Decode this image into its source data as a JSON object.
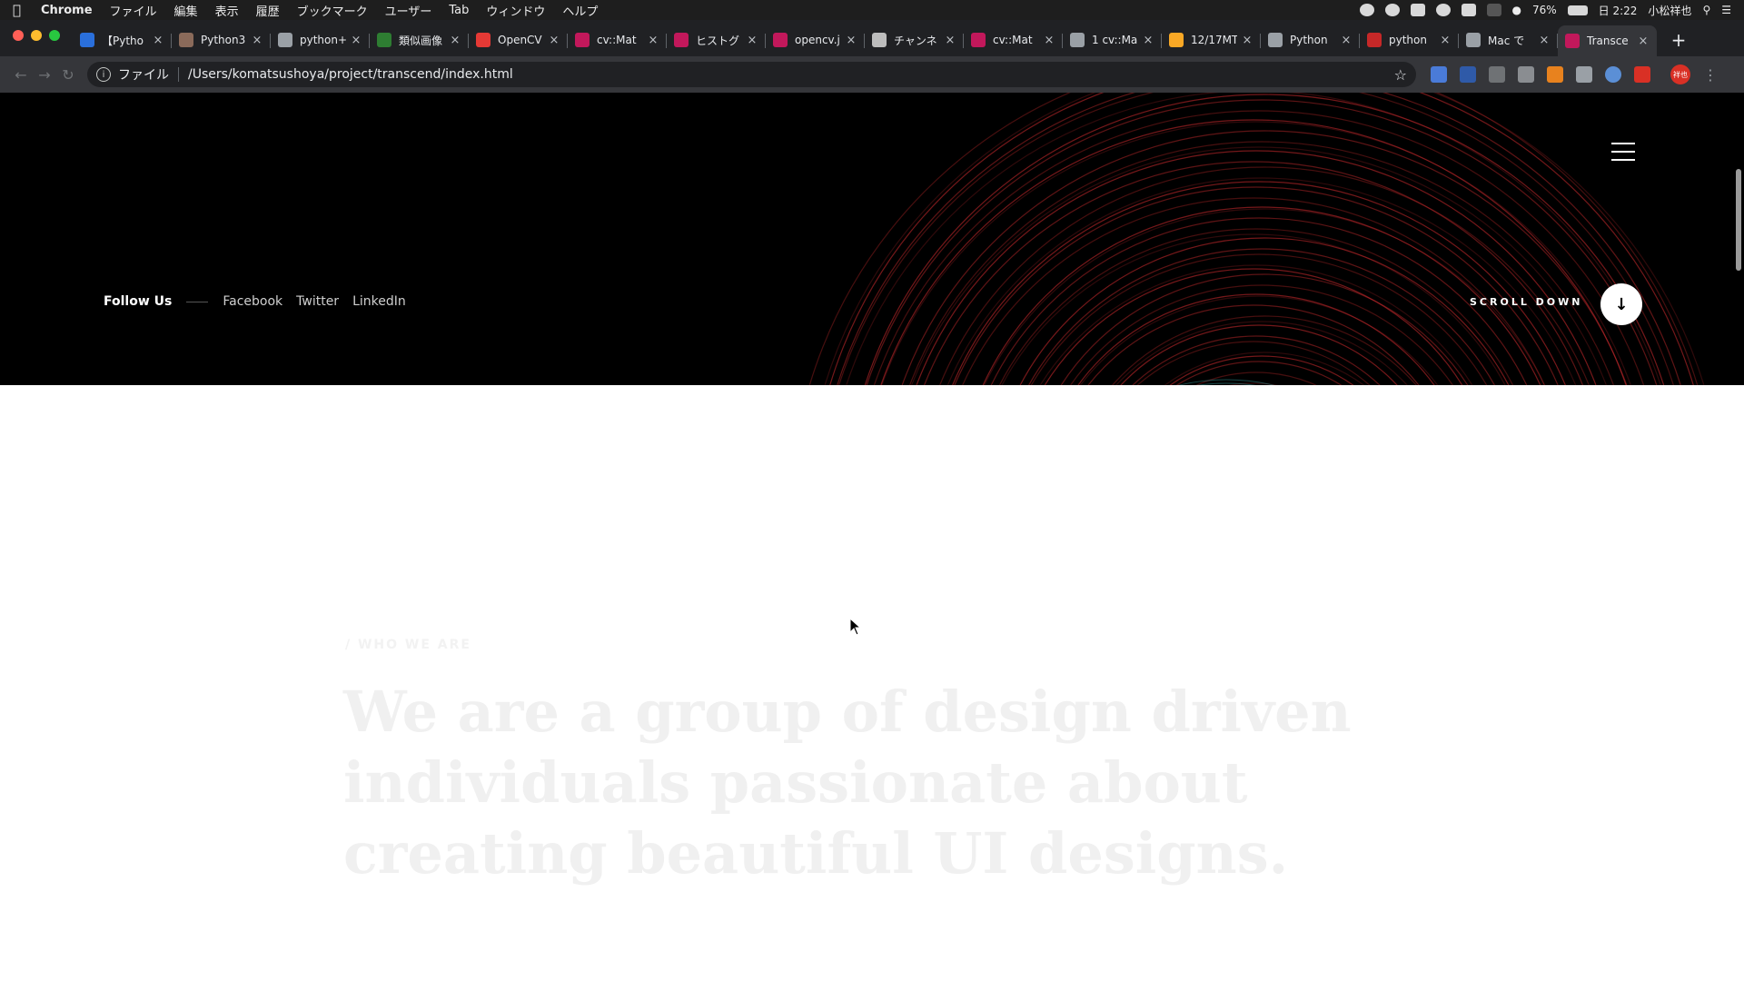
{
  "menubar": {
    "app": "Chrome",
    "items": [
      "ファイル",
      "編集",
      "表示",
      "履歴",
      "ブックマーク",
      "ユーザー",
      "Tab",
      "ウィンドウ",
      "ヘルプ"
    ],
    "battery": "76%",
    "clock": "日 2:22",
    "user": "小松祥也"
  },
  "tabs": [
    {
      "title": "【Pytho",
      "color": "#2a6fdb"
    },
    {
      "title": "Python3",
      "color": "#8a6a5a"
    },
    {
      "title": "python+",
      "color": "#9aa0a6"
    },
    {
      "title": "類似画像",
      "color": "#2e7d32"
    },
    {
      "title": "OpenCV",
      "color": "#e53935"
    },
    {
      "title": "cv::Mat",
      "color": "#c2185b"
    },
    {
      "title": "ヒストグ",
      "color": "#c2185b"
    },
    {
      "title": "opencv.j",
      "color": "#c2185b"
    },
    {
      "title": "チャンネ",
      "color": "#bdbdbd"
    },
    {
      "title": "cv::Mat",
      "color": "#c2185b"
    },
    {
      "title": "1 cv::Ma",
      "color": "#9aa0a6"
    },
    {
      "title": "12/17MT",
      "color": "#f9a825"
    },
    {
      "title": "Python",
      "color": "#9aa0a6"
    },
    {
      "title": "python",
      "color": "#c62828"
    },
    {
      "title": "Mac で",
      "color": "#9aa0a6"
    },
    {
      "title": "Transce",
      "color": "#c2185b",
      "active": true
    }
  ],
  "omnibox": {
    "scheme": "ファイル",
    "url": "/Users/komatsushoya/project/transcend/index.html"
  },
  "profile_initials": "祥也",
  "hero": {
    "follow_label": "Follow Us",
    "social": [
      "Facebook",
      "Twitter",
      "LinkedIn"
    ],
    "scroll_label": "SCROLL DOWN"
  },
  "about": {
    "eyebrow": "/ WHO WE ARE",
    "headline": "We are a group of design driven individuals passionate about creating beautiful UI designs."
  },
  "colors": {
    "hero_bg": "#000000",
    "ring_red": "#c0282a",
    "ring_teal": "#3aa6a6"
  }
}
